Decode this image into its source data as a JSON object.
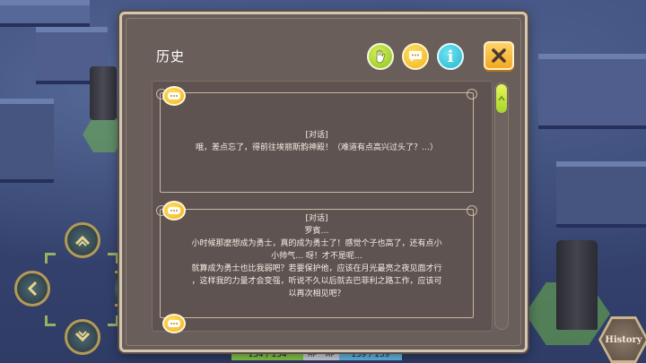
{
  "window": {
    "title": "历史"
  },
  "toolbar": {
    "hand_icon": "hand-icon",
    "chat_icon": "chat-bubble-icon",
    "info_icon": "info-icon",
    "info_glyph": "i",
    "close_icon": "close-icon"
  },
  "entries": [
    {
      "tag": "[对话]",
      "lines": [
        "哦，差点忘了，得前往埃丽斯韵神殿！（难道有点高兴过头了？…）"
      ]
    },
    {
      "tag": "[对话]",
      "lines": [
        "罗賓…",
        "小时候那麼想成为勇士，真的成为勇士了！感觉个子也高了，还有点小",
        "小帅气… 呀！才不是呢…",
        "就算成为勇士也比我弱吧？若要保护他，应该在月光最亮之夜见面才行",
        "，这样我的力量才会变强，听说不久以后就去巴菲利之路工作，应该可",
        "以再次相见吧？"
      ]
    }
  ],
  "status": {
    "hp": "134 / 134",
    "hp_label": "HP",
    "mp_label": "MP",
    "mp": "139 / 139"
  },
  "history_button": {
    "label": "History"
  },
  "colors": {
    "panel": "#6a5e5b",
    "accent_yellow": "#f0b21a",
    "accent_green": "#8bc323",
    "accent_cyan": "#25b6cc",
    "hp_green": "#86c94a",
    "mp_blue": "#63b8e8"
  }
}
